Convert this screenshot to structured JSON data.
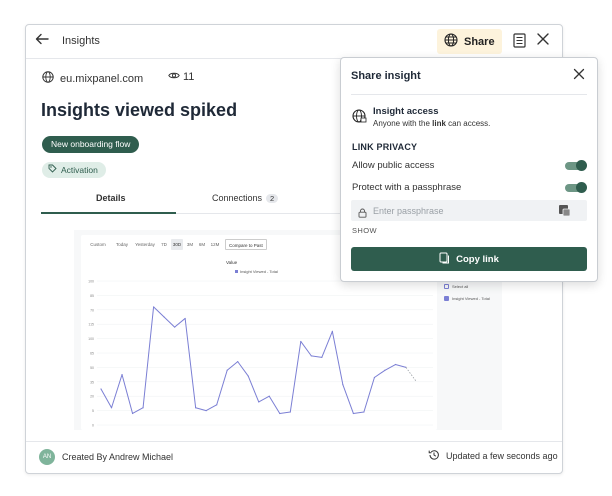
{
  "header": {
    "breadcrumb": "Insights",
    "share_label": "Share",
    "icons": [
      "back-arrow-icon",
      "globe-share-icon",
      "notes-icon",
      "close-icon"
    ]
  },
  "meta": {
    "domain": "eu.mixpanel.com",
    "view_count": "11"
  },
  "page_title": "Insights viewed spiked",
  "tags": {
    "primary": "New onboarding flow",
    "secondary": "Activation"
  },
  "tabs": [
    {
      "label": "Details",
      "active": true
    },
    {
      "label": "Connections",
      "count": "2",
      "active": false
    }
  ],
  "chart_toolbar": {
    "ranges": [
      "Custom",
      "Today",
      "Yesterday",
      "7D",
      "30D",
      "3M",
      "6M",
      "12M"
    ],
    "selected_range": "30D",
    "compare_label": "Compare to Past",
    "metric_label": "Value",
    "legend_label": "Insight Viewed - Total"
  },
  "chart_data": {
    "type": "line",
    "title": "",
    "xlabel": "",
    "ylabel": "",
    "yticks": [
      "0",
      "5",
      "20",
      "35",
      "50",
      "65",
      "100",
      "115",
      "70",
      "85",
      "100"
    ],
    "ylim": [
      0,
      100
    ],
    "series": [
      {
        "name": "Insight Viewed - Total",
        "color": "#7b7fd4",
        "values": [
          25,
          12,
          35,
          8,
          12,
          82,
          75,
          68,
          74,
          12,
          10,
          14,
          38,
          44,
          34,
          16,
          20,
          8,
          9,
          58,
          48,
          47,
          65,
          28,
          8,
          9,
          33,
          38,
          42,
          40
        ],
        "projected_tail": [
          40,
          30
        ]
      }
    ],
    "grid": true,
    "legend_placement": "top"
  },
  "chart_side_legend": {
    "select_all": "Select all",
    "series_label": "Insight Viewed - Total"
  },
  "footer": {
    "avatar_initials": "AN",
    "created_by": "Created By Andrew Michael",
    "updated": "Updated a few seconds ago"
  },
  "share_popup": {
    "title": "Share insight",
    "access_title": "Insight access",
    "access_desc_pre": "Anyone with the ",
    "access_desc_bold": "link",
    "access_desc_post": " can access.",
    "privacy_heading": "LINK PRIVACY",
    "allow_public_label": "Allow public access",
    "allow_public_on": true,
    "passphrase_label": "Protect with a passphrase",
    "passphrase_on": true,
    "passphrase_placeholder": "Enter passphrase",
    "show_label": "SHOW",
    "copy_link_label": "Copy link",
    "accent_color": "#2f5d4e"
  }
}
